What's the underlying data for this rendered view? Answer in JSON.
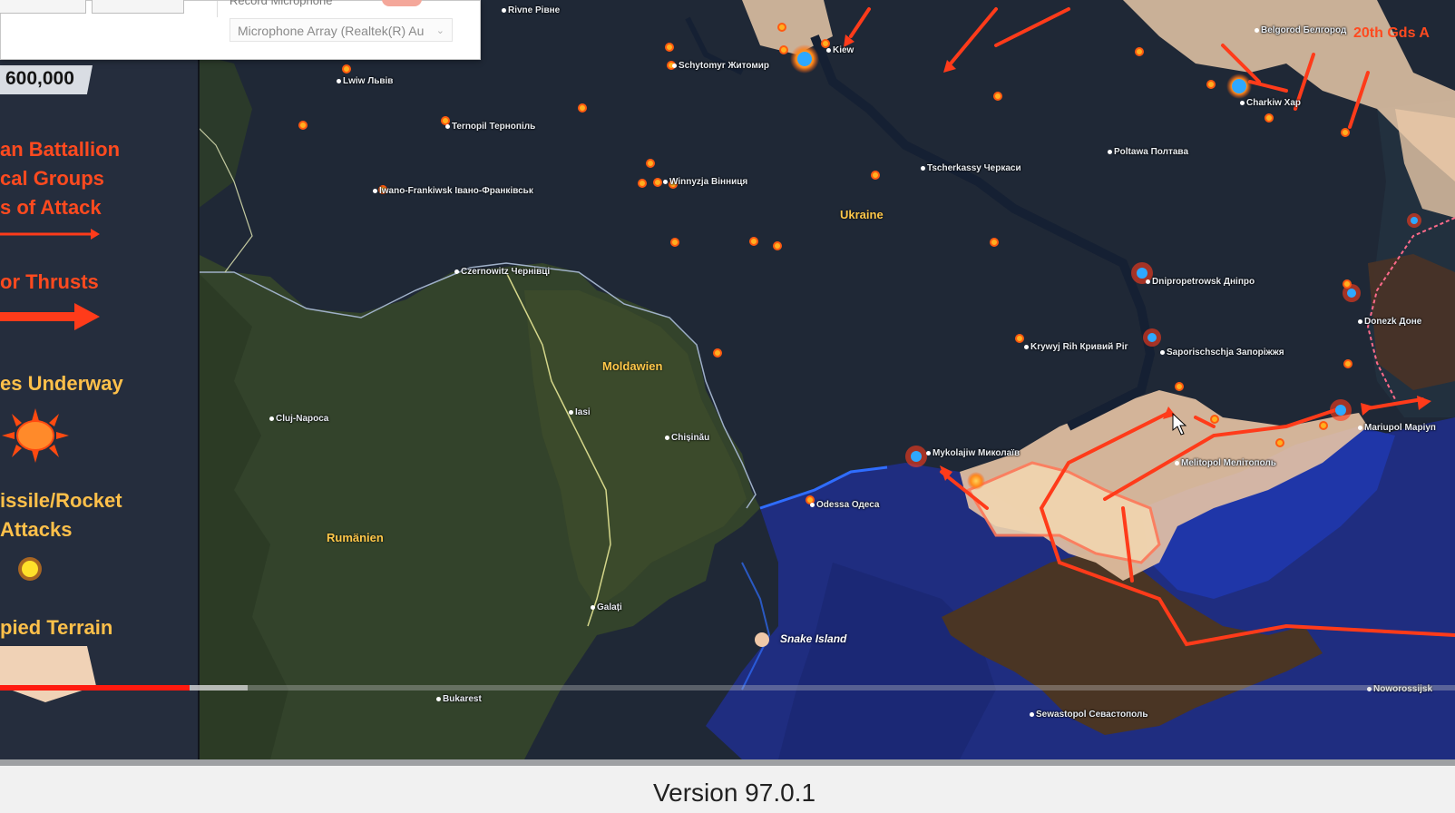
{
  "popup": {
    "record_label": "Record Microphone",
    "mic_select_value": "Microphone Array (Realtek(R) Au",
    "toggle_color": "#f4a79a"
  },
  "legend": {
    "population": "600,000",
    "battalion_lines": [
      "an Battallion",
      "cal Groups",
      "s of Attack"
    ],
    "thrusts_label": "or Thrusts",
    "underway_label": "es Underway",
    "missile_lines": [
      "issile/Rocket",
      "Attacks"
    ],
    "terrain_label": "pied Terrain",
    "icons": [
      "attack-arrow-icon",
      "major-thrust-arrow-icon",
      "battle-burst-icon",
      "missile-dot-icon",
      "occupied-terrain-swatch"
    ]
  },
  "map": {
    "regions": {
      "ukraine": "Ukraine",
      "moldova": "Moldawien",
      "romania": "Rumänien"
    },
    "snake_island": "Snake Island",
    "unit_label": "20th Gds A",
    "cities": {
      "rivne": "Rivne Рівне",
      "kiev": "Kiew",
      "zhytomyr": "Schytomyr Житомир",
      "belgorod": "Belgorod Белгород",
      "lviv": "Lwiw Львів",
      "ternopil": "Ternopil Тернопіль",
      "kharkiv": "Charkiw Хар",
      "poltava": "Poltawa Полтава",
      "cherkassy": "Tscherkassy Черкаси",
      "vinnytsia": "Winnyzja Вінниця",
      "ivano": "Iwano-Frankiwsk Івано-Франківськ",
      "czernowitz": "Czernowitz Чернівці",
      "dnipro": "Dnipropetrowsk Дніпро",
      "donetsk": "Donezk Доне",
      "kryvyi": "Krywyj Rih Кривий Ріг",
      "zaporizhzhia": "Saporischschja Запоріжжя",
      "mariupol": "Mariupol Маріуп",
      "mykolaiv": "Mykolajiw Миколаїв",
      "melitopol": "Melitopol Мелітополь",
      "odessa": "Odessa Одеса",
      "iasi": "Iasi",
      "chisinau": "Chișinău",
      "cluj": "Cluj-Napoca",
      "galati": "Galați",
      "bucharest": "Bukarest",
      "sevastopol": "Sewastopol Севастополь",
      "novorossiysk": "Noworossijsk"
    },
    "colors": {
      "attack": "#ff3b1a",
      "occupied": "#e8c8a8",
      "sea": "#1f2f80",
      "land": "#1e2a3a"
    }
  },
  "player": {
    "played_fraction": 0.13,
    "buffered_fraction": 0.17
  },
  "footer": {
    "version": "Version 97.0.1"
  }
}
